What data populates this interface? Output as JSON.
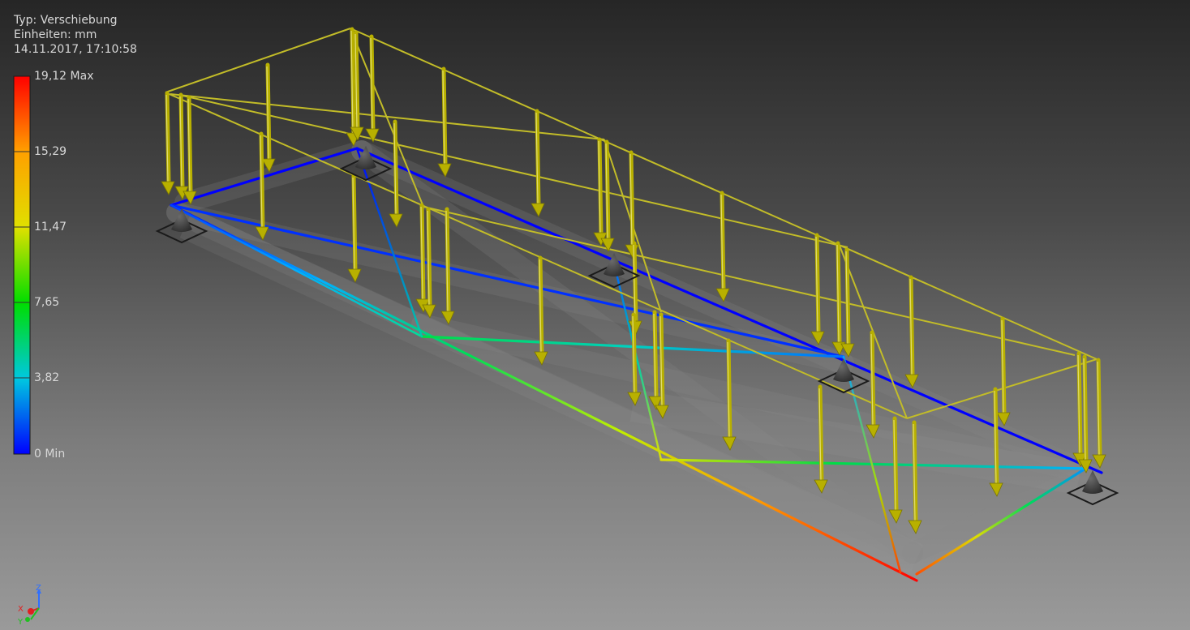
{
  "info": {
    "type_line": "Typ: Verschiebung",
    "units_line": "Einheiten: mm",
    "timestamp_line": "14.11.2017, 17:10:58"
  },
  "legend": {
    "labels": [
      "19,12 Max",
      "15,29",
      "11,47",
      "7,65",
      "3,82",
      "0 Min"
    ],
    "colors": {
      "max": "#ff0000",
      "high": "#ffa000",
      "mid_high": "#e0e000",
      "mid": "#00dd00",
      "mid_low": "#00d0d0",
      "low": "#0080ff",
      "min": "#0000ff"
    }
  },
  "triad": {
    "z_label": "Z",
    "x_label": "X",
    "y_label": "Y"
  },
  "colors": {
    "load_arrow": "#b8b000",
    "load_frame": "#c2bc28",
    "support": "#3a3a3a",
    "ghost_member": "#8a8a8a"
  }
}
